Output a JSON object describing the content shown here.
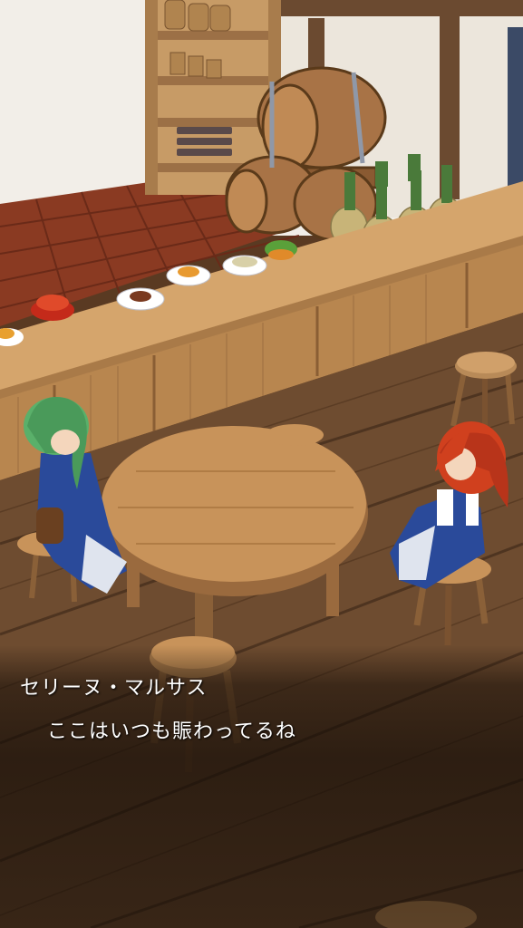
{
  "dialog": {
    "speaker": "セリーヌ・マルサス",
    "line": "ここはいつも賑わってるね"
  },
  "scene": {
    "characters": [
      "green-haired-girl",
      "red-haired-girl"
    ],
    "colors": {
      "floor": "#6b4a30",
      "counter": "#c4955f",
      "tile": "#8a3a22",
      "wall": "#f4f1ec"
    }
  }
}
